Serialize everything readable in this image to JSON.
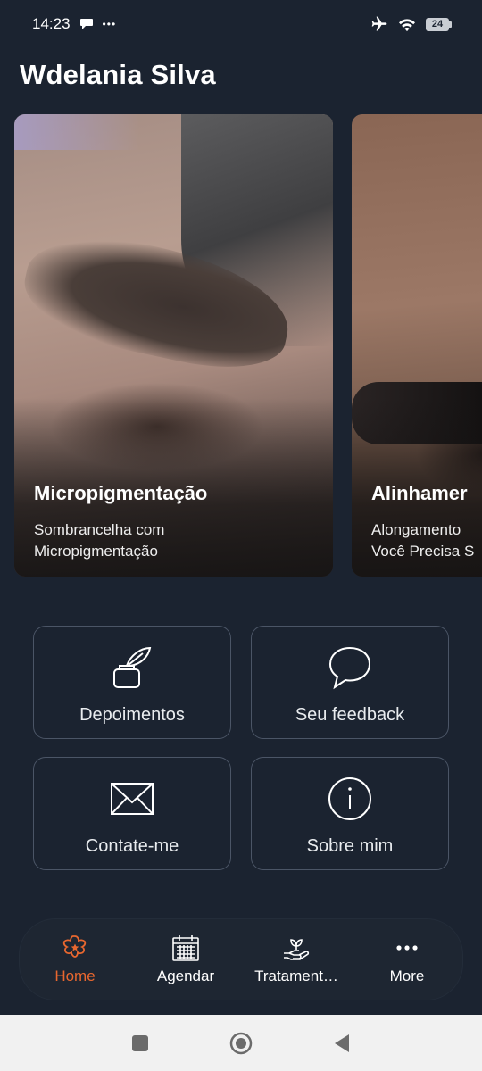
{
  "status_bar": {
    "time": "14:23",
    "more": "•••",
    "battery": "24"
  },
  "header": {
    "title": "Wdelania Silva"
  },
  "carousel": [
    {
      "title": "Micropigmentação",
      "subtitle_line1": "Sombrancelha com",
      "subtitle_line2": "Micropigmentação"
    },
    {
      "title": "Alinhamer",
      "subtitle_line1": "Alongamento",
      "subtitle_line2": "Você Precisa S"
    }
  ],
  "menu": [
    {
      "label": "Depoimentos",
      "icon": "ink-feather-icon"
    },
    {
      "label": "Seu feedback",
      "icon": "chat-bubble-icon"
    },
    {
      "label": "Contate-me",
      "icon": "envelope-icon"
    },
    {
      "label": "Sobre mim",
      "icon": "info-icon"
    }
  ],
  "bottom_nav": {
    "items": [
      {
        "label": "Home",
        "icon": "flower-star-icon",
        "active": true
      },
      {
        "label": "Agendar",
        "icon": "calendar-icon"
      },
      {
        "label": "Tratament…",
        "icon": "hand-leaf-icon"
      },
      {
        "label": "More",
        "icon": "more-dots-icon"
      }
    ]
  },
  "colors": {
    "background": "#1b2330",
    "accent": "#e8672f",
    "tile_border": "#4b5566"
  }
}
